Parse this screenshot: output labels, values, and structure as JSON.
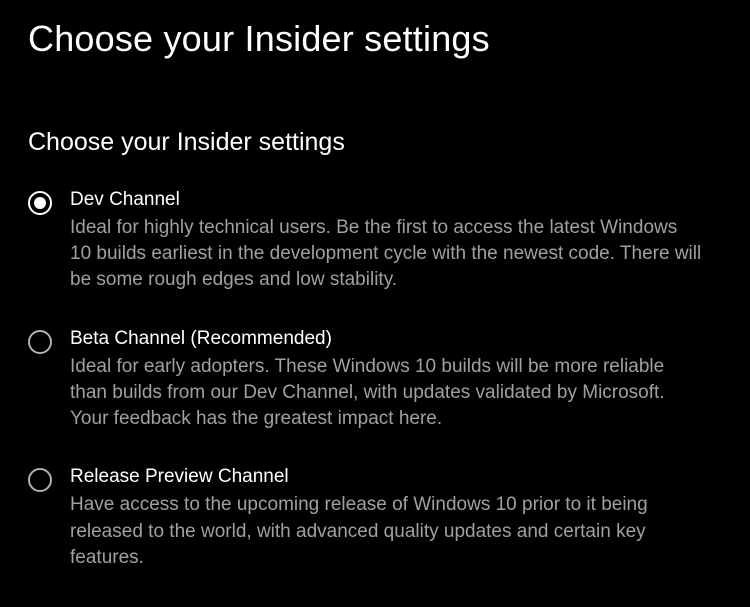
{
  "page_title": "Choose your Insider settings",
  "section_heading": "Choose your Insider settings",
  "selected_index": 0,
  "options": [
    {
      "title": "Dev Channel",
      "description": "Ideal for highly technical users. Be the first to access the latest Windows 10 builds earliest in the development cycle with the newest code. There will be some rough edges and low stability."
    },
    {
      "title": "Beta Channel (Recommended)",
      "description": "Ideal for early adopters. These Windows 10 builds will be more reliable than builds from our Dev Channel, with updates validated by Microsoft. Your feedback has the greatest impact here."
    },
    {
      "title": "Release Preview Channel",
      "description": "Have access to the upcoming release of Windows 10 prior to it being released to the world, with advanced quality updates and certain key features."
    }
  ]
}
